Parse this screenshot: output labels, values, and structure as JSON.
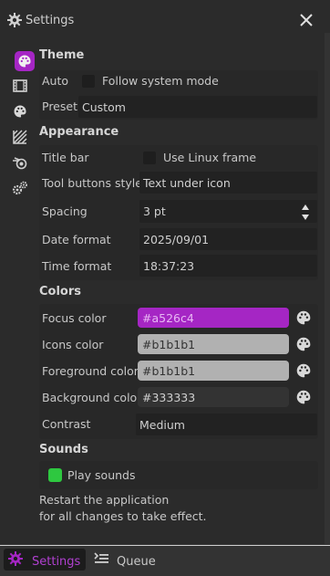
{
  "window": {
    "title": "Settings"
  },
  "sidebar": {
    "icons": [
      "palette-icon",
      "film-icon",
      "palette-icon",
      "texture-icon",
      "blender-icon",
      "gears-icon"
    ]
  },
  "theme": {
    "section": "Theme",
    "auto_label": "Auto",
    "follow_system_label": "Follow system mode",
    "preset_label": "Preset",
    "preset_value": "Custom"
  },
  "appearance": {
    "section": "Appearance",
    "title_bar_label": "Title bar",
    "use_linux_frame_label": "Use Linux frame",
    "tool_buttons_label": "Tool buttons style",
    "tool_buttons_value": "Text under icon",
    "spacing_label": "Spacing",
    "spacing_value": "3 pt",
    "date_format_label": "Date format",
    "date_format_value": "2025/09/01",
    "time_format_label": "Time format",
    "time_format_value": "18:37:23"
  },
  "colors": {
    "section": "Colors",
    "focus_label": "Focus color",
    "focus_value": "#a526c4",
    "icons_label": "Icons color",
    "icons_value": "#b1b1b1",
    "foreground_label": "Foreground color",
    "foreground_value": "#b1b1b1",
    "background_label": "Background color",
    "background_value": "#333333",
    "contrast_label": "Contrast",
    "contrast_value": "Medium"
  },
  "sounds": {
    "section": "Sounds",
    "play_sounds_label": "Play sounds",
    "play_sounds_checked": true
  },
  "notice": {
    "line1": "Restart the application",
    "line2": "for all changes to take effect."
  },
  "tabs": {
    "settings_label": "Settings",
    "queue_label": "Queue"
  },
  "palette": {
    "accent": "#a526c4",
    "check_green": "#2ec840"
  }
}
